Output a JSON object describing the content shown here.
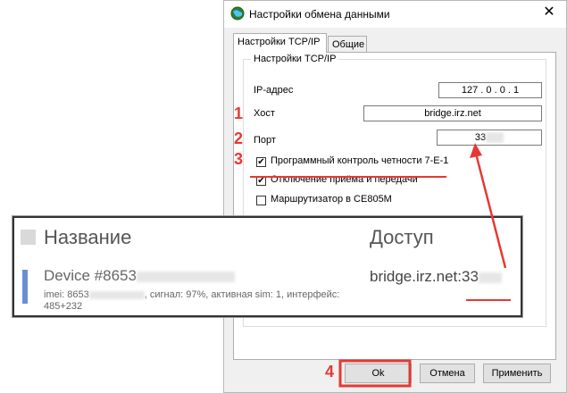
{
  "dialog": {
    "title": "Настройки обмена данными",
    "close_label": "✕",
    "tabs": [
      {
        "label": "Настройки TCP/IP"
      },
      {
        "label": "Общие"
      }
    ],
    "group_title": "Настройки TCP/IP",
    "ip_label": "IP-адрес",
    "ip_value": "127 . 0 . 0 . 1",
    "host_label": "Хост",
    "host_value": "bridge.irz.net",
    "port_label": "Порт",
    "port_value": "33",
    "checkboxes": [
      {
        "label": "Программный контроль четности 7-E-1",
        "checked": "✔"
      },
      {
        "label": "Отключение приёма и передачи",
        "checked": "✔"
      },
      {
        "label": "Маршрутизатор в CE805M",
        "checked": ""
      }
    ],
    "buttons": {
      "ok": "Ok",
      "cancel": "Отмена",
      "apply": "Применить"
    }
  },
  "annotations": {
    "n1": "1",
    "n2": "2",
    "n3": "3",
    "n4": "4"
  },
  "overlay_card": {
    "header_name": "Название",
    "header_access": "Доступ",
    "device_name": "Device #8653",
    "meta_prefix": "imei: 8653",
    "meta_suffix": ", сигнал: 97%, активная sim: 1, интерфейс:",
    "meta_line2": "485+232",
    "access_value": "bridge.irz.net:33"
  },
  "colors": {
    "annotation": "#e53935",
    "stripe": "#6b8dd6"
  }
}
